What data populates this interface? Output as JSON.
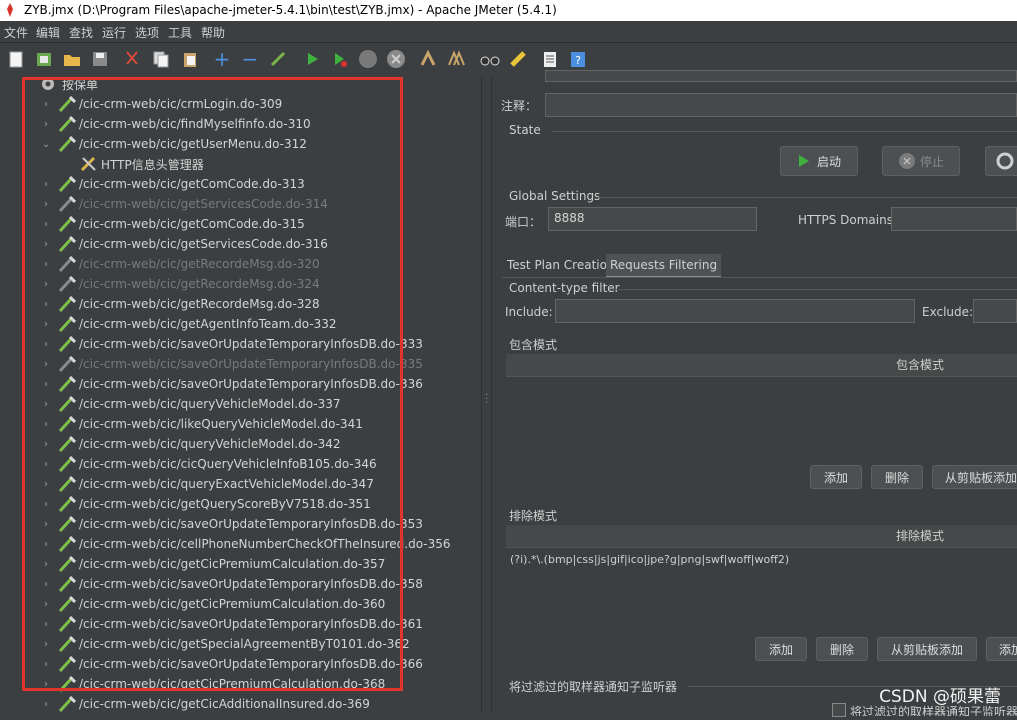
{
  "window": {
    "title": "ZYB.jmx (D:\\Program Files\\apache-jmeter-5.4.1\\bin\\test\\ZYB.jmx) - Apache JMeter (5.4.1)"
  },
  "menu": [
    "文件",
    "编辑",
    "查找",
    "运行",
    "选项",
    "工具",
    "帮助"
  ],
  "toolbar_icons": [
    "new-icon",
    "templates-icon",
    "open-icon",
    "save-icon",
    "cut-icon",
    "copy-icon",
    "paste-icon",
    "expand-icon",
    "collapse-icon",
    "toggle-icon",
    "start-icon",
    "start-no-timers-icon",
    "stop-icon",
    "shutdown-icon",
    "clear-icon",
    "clear-all-icon",
    "search-icon",
    "reset-search-icon",
    "function-helper-icon",
    "help-icon"
  ],
  "tree": {
    "root_label": "按保单",
    "items": [
      {
        "label": "/cic-crm-web/cic/crmLogin.do-309",
        "disabled": false,
        "expanded": false
      },
      {
        "label": "/cic-crm-web/cic/findMyselfinfo.do-310",
        "disabled": false,
        "expanded": false
      },
      {
        "label": "/cic-crm-web/cic/getUserMenu.do-312",
        "disabled": false,
        "expanded": true
      },
      {
        "label": "HTTP信息头管理器",
        "disabled": false,
        "child": true
      },
      {
        "label": "/cic-crm-web/cic/getComCode.do-313",
        "disabled": false,
        "expanded": false
      },
      {
        "label": "/cic-crm-web/cic/getServicesCode.do-314",
        "disabled": true,
        "expanded": false
      },
      {
        "label": "/cic-crm-web/cic/getComCode.do-315",
        "disabled": false,
        "expanded": false
      },
      {
        "label": "/cic-crm-web/cic/getServicesCode.do-316",
        "disabled": false,
        "expanded": false
      },
      {
        "label": "/cic-crm-web/cic/getRecordeMsg.do-320",
        "disabled": true,
        "expanded": false
      },
      {
        "label": "/cic-crm-web/cic/getRecordeMsg.do-324",
        "disabled": true,
        "expanded": false
      },
      {
        "label": "/cic-crm-web/cic/getRecordeMsg.do-328",
        "disabled": false,
        "expanded": false
      },
      {
        "label": "/cic-crm-web/cic/getAgentInfoTeam.do-332",
        "disabled": false,
        "expanded": false
      },
      {
        "label": "/cic-crm-web/cic/saveOrUpdateTemporaryInfosDB.do-333",
        "disabled": false,
        "expanded": false
      },
      {
        "label": "/cic-crm-web/cic/saveOrUpdateTemporaryInfosDB.do-335",
        "disabled": true,
        "expanded": false
      },
      {
        "label": "/cic-crm-web/cic/saveOrUpdateTemporaryInfosDB.do-336",
        "disabled": false,
        "expanded": false
      },
      {
        "label": "/cic-crm-web/cic/queryVehicleModel.do-337",
        "disabled": false,
        "expanded": false
      },
      {
        "label": "/cic-crm-web/cic/likeQueryVehicleModel.do-341",
        "disabled": false,
        "expanded": false
      },
      {
        "label": "/cic-crm-web/cic/queryVehicleModel.do-342",
        "disabled": false,
        "expanded": false
      },
      {
        "label": "/cic-crm-web/cic/cicQueryVehicleInfoB105.do-346",
        "disabled": false,
        "expanded": false
      },
      {
        "label": "/cic-crm-web/cic/queryExactVehicleModel.do-347",
        "disabled": false,
        "expanded": false
      },
      {
        "label": "/cic-crm-web/cic/getQueryScoreByV7518.do-351",
        "disabled": false,
        "expanded": false
      },
      {
        "label": "/cic-crm-web/cic/saveOrUpdateTemporaryInfosDB.do-353",
        "disabled": false,
        "expanded": false
      },
      {
        "label": "/cic-crm-web/cic/cellPhoneNumberCheckOfTheInsured.do-356",
        "disabled": false,
        "expanded": false
      },
      {
        "label": "/cic-crm-web/cic/getCicPremiumCalculation.do-357",
        "disabled": false,
        "expanded": false
      },
      {
        "label": "/cic-crm-web/cic/saveOrUpdateTemporaryInfosDB.do-358",
        "disabled": false,
        "expanded": false
      },
      {
        "label": "/cic-crm-web/cic/getCicPremiumCalculation.do-360",
        "disabled": false,
        "expanded": false
      },
      {
        "label": "/cic-crm-web/cic/saveOrUpdateTemporaryInfosDB.do-361",
        "disabled": false,
        "expanded": false
      },
      {
        "label": "/cic-crm-web/cic/getSpecialAgreementByT0101.do-362",
        "disabled": false,
        "expanded": false
      },
      {
        "label": "/cic-crm-web/cic/saveOrUpdateTemporaryInfosDB.do-366",
        "disabled": false,
        "expanded": false
      },
      {
        "label": "/cic-crm-web/cic/getCicPremiumCalculation.do-368",
        "disabled": false,
        "expanded": false
      },
      {
        "label": "/cic-crm-web/cic/getCicAdditionalInsured.do-369",
        "disabled": false,
        "expanded": false
      }
    ]
  },
  "panel": {
    "comment_label": "注释：",
    "comment_value": "",
    "state_label": "State",
    "start_button": "启动",
    "stop_button": "停止",
    "global_settings_label": "Global Settings",
    "port_label": "端口：",
    "port_value": "8888",
    "https_domains_label": "HTTPS Domains:",
    "https_domains_value": "",
    "tabs": [
      "Test Plan Creation",
      "Requests Filtering"
    ],
    "active_tab": "Requests Filtering",
    "content_type_filter_label": "Content-type filter",
    "include_label": "Include:",
    "include_value": "",
    "exclude_label": "Exclude:",
    "exclude_value": "",
    "include_patterns_label": "包含模式",
    "include_patterns_header": "包含模式",
    "include_buttons": [
      "添加",
      "删除",
      "从剪贴板添加"
    ],
    "exclude_patterns_label": "排除模式",
    "exclude_patterns_header": "排除模式",
    "exclude_patterns_rows": [
      "(?i).*\\.(bmp|css|js|gif|ico|jpe?g|png|swf|woff|woff2)"
    ],
    "exclude_buttons": [
      "添加",
      "删除",
      "从剪贴板添加",
      "添加"
    ],
    "notify_label": "将过滤过的取样器通知子监听器",
    "notify_checkbox_label": "将过滤过的取样器通知子监听器"
  },
  "watermark": "CSDN @硕果蕾"
}
